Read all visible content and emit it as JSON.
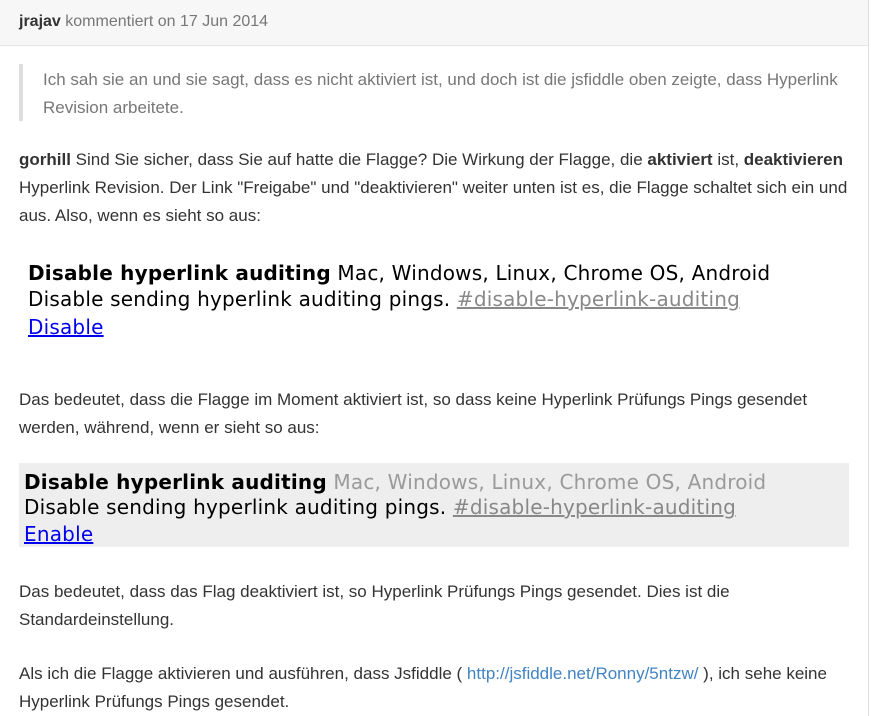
{
  "header": {
    "author": "jrajav",
    "action_text": "kommentiert on 17 Jun 2014"
  },
  "quote": {
    "text": "Ich sah sie an und sie sagt, dass es nicht aktiviert ist, und doch ist die jsfiddle oben zeigte, dass Hyperlink Revision arbeitete."
  },
  "paragraph1": {
    "mention": "gorhill",
    "t1": " Sind Sie sicher, dass Sie auf hatte die Flagge? Die Wirkung der Flagge, die ",
    "bold1": "aktiviert",
    "t2": " ist, ",
    "bold2": "deaktivieren",
    "t3": " Hyperlink Revision. Der Link \"Freigabe\" und \"deaktivieren\" weiter unten ist es, die Flagge schaltet sich ein und aus. Also, wenn es sieht so aus:"
  },
  "flag_enabled": {
    "name": "Disable hyperlink auditing",
    "platforms": " Mac, Windows, Linux, Chrome OS, Android",
    "description": "Disable sending hyperlink auditing pings. ",
    "anchor": "#disable-hyperlink-auditing",
    "action": "Disable"
  },
  "paragraph2": {
    "text": "Das bedeutet, dass die Flagge im Moment aktiviert ist, so dass keine Hyperlink Prüfungs Pings gesendet werden, während, wenn er sieht so aus:"
  },
  "flag_disabled": {
    "name": "Disable hyperlink auditing",
    "platforms": " Mac, Windows, Linux, Chrome OS, Android",
    "description": "Disable sending hyperlink auditing pings. ",
    "anchor": "#disable-hyperlink-auditing",
    "action": "Enable"
  },
  "paragraph3": {
    "text": "Das bedeutet, dass das Flag deaktiviert ist, so Hyperlink Prüfungs Pings gesendet. Dies ist die Standardeinstellung."
  },
  "paragraph4": {
    "t1": "Als ich die Flagge aktivieren und ausführen, dass Jsfiddle ( ",
    "link": "http://jsfiddle.net/Ronny/5ntzw/",
    "t2": " ), ich sehe keine Hyperlink Prüfungs Pings gesendet."
  },
  "colors": {
    "link": "#4183c4",
    "flag_action_link": "#0000ee",
    "header_bg": "#f7f7f7",
    "disabled_flag_bg": "#eeeeee"
  }
}
